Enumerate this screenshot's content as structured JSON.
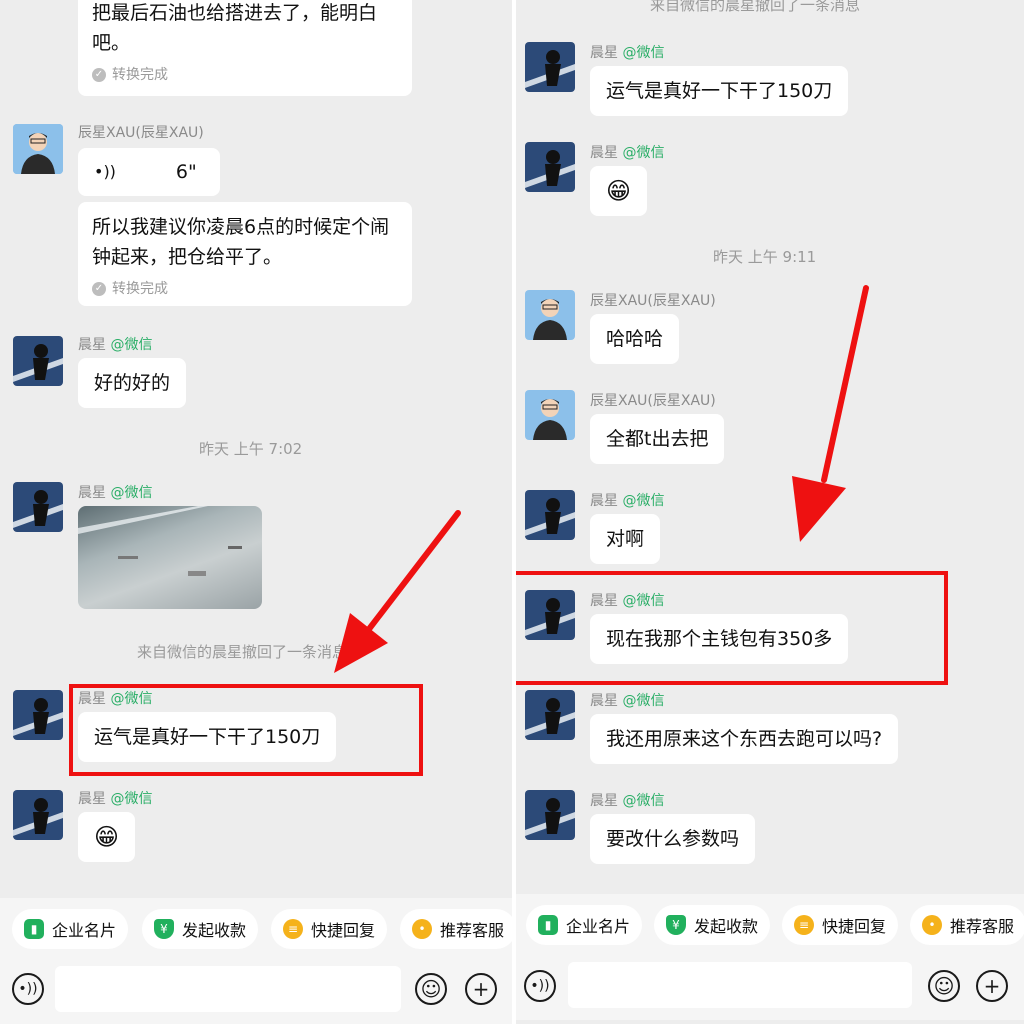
{
  "left": {
    "top_msg": {
      "text": "把最后石油也给搭进去了，能明白吧。",
      "converted": "转换完成"
    },
    "msg_xau_voice": {
      "sender": "辰星XAU(辰星XAU)",
      "voice_icon": "•))",
      "duration": "6\"",
      "text": "所以我建议你凌晨6点的时候定个闹钟起来，把仓给平了。",
      "converted": "转换完成"
    },
    "msg_ok": {
      "sender_name": "晨星",
      "sender_tag": "@微信",
      "text": "好的好的"
    },
    "time1": "昨天 上午 7:02",
    "msg_img": {
      "sender_name": "晨星",
      "sender_tag": "@微信"
    },
    "sys_recall": "来自微信的晨星撤回了一条消息",
    "msg_luck": {
      "sender_name": "晨星",
      "sender_tag": "@微信",
      "text": "运气是真好一下干了150刀"
    },
    "msg_emoji": {
      "sender_name": "晨星",
      "sender_tag": "@微信",
      "text": "😁"
    }
  },
  "right": {
    "top_sys": "来自微信的晨星撤回了一条消息",
    "msg_luck": {
      "sender_name": "晨星",
      "sender_tag": "@微信",
      "text": "运气是真好一下干了150刀"
    },
    "msg_emoji": {
      "sender_name": "晨星",
      "sender_tag": "@微信",
      "text": "😁"
    },
    "time1": "昨天 上午 9:11",
    "msg_haha": {
      "sender": "辰星XAU(辰星XAU)",
      "text": "哈哈哈"
    },
    "msg_all": {
      "sender": "辰星XAU(辰星XAU)",
      "text": "全都t出去把"
    },
    "msg_yes": {
      "sender_name": "晨星",
      "sender_tag": "@微信",
      "text": "对啊"
    },
    "msg_wallet": {
      "sender_name": "晨星",
      "sender_tag": "@微信",
      "text": "现在我那个主钱包有350多"
    },
    "msg_ask": {
      "sender_name": "晨星",
      "sender_tag": "@微信",
      "text": "我还用原来这个东西去跑可以吗?"
    },
    "msg_param": {
      "sender_name": "晨星",
      "sender_tag": "@微信",
      "text": "要改什么参数吗"
    }
  },
  "quick_actions": [
    "企业名片",
    "发起收款",
    "快捷回复",
    "推荐客服"
  ],
  "icons": {
    "card": "card-icon",
    "pay": "yuan-icon",
    "reply": "reply-icon",
    "service": "service-icon",
    "voice": "voice-icon",
    "emoji": "emoji-icon",
    "plus": "plus-icon"
  },
  "colors": {
    "bg": "#ededed",
    "tag_green": "#2aae67",
    "highlight_red": "#ee1111",
    "yellow": "#f5b21b",
    "green": "#21b05d"
  }
}
